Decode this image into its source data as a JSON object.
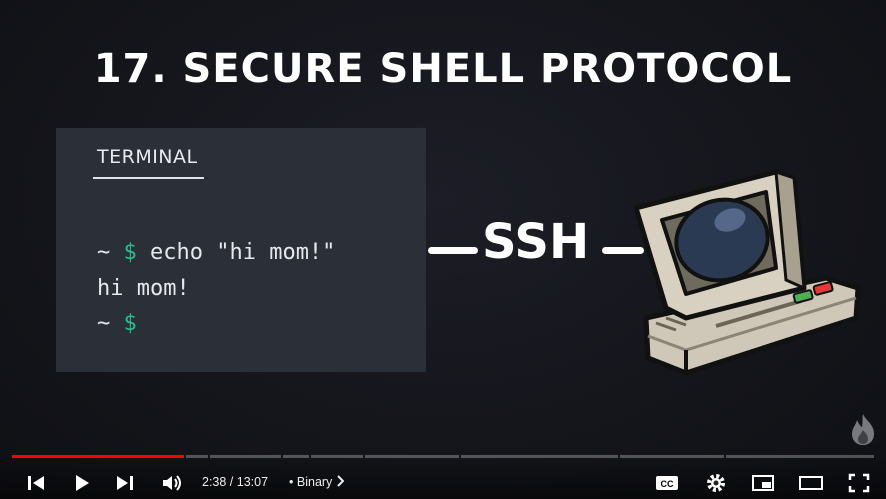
{
  "video": {
    "slide_title": "17. SECURE SHELL PROTOCOL",
    "terminal": {
      "tab_label": "TERMINAL",
      "line1_prompt": "~ ",
      "line1_dollar": "$",
      "line1_command": " echo \"hi mom!\"",
      "line2_output": "hi mom!",
      "line3_prompt": "~ ",
      "line3_dollar": "$"
    },
    "ssh_label": "SSH",
    "colors": {
      "prompt_green": "#27c08a",
      "progress_red": "#ff0000"
    }
  },
  "player": {
    "time_display": "2:38 / 13:07",
    "chapter_separator": "•",
    "chapter_label": "Binary",
    "icons": {
      "previous": "previous-icon",
      "play": "play-icon",
      "next": "next-icon",
      "volume": "volume-icon",
      "captions": "captions-icon",
      "settings": "gear-icon",
      "miniplayer": "miniplayer-icon",
      "theater": "theater-mode-icon",
      "fullscreen": "fullscreen-icon",
      "channel_watermark": "fire-logo-icon"
    },
    "progress_fraction": 0.2
  }
}
